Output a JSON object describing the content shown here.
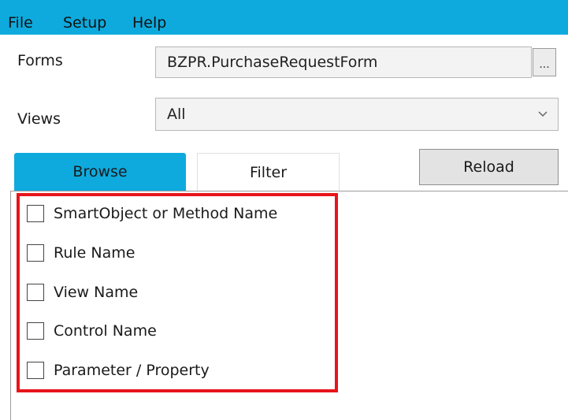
{
  "menu": {
    "file": "File",
    "setup": "Setup",
    "help": "Help"
  },
  "forms": {
    "label": "Forms",
    "value": "BZPR.PurchaseRequestForm",
    "browse_label": "..."
  },
  "views": {
    "label": "Views",
    "selected": "All"
  },
  "tabs": [
    {
      "label": "Browse",
      "active": true
    },
    {
      "label": "Filter",
      "active": false
    }
  ],
  "reload_label": "Reload",
  "filters": [
    {
      "label": "SmartObject or Method Name",
      "checked": false
    },
    {
      "label": "Rule Name",
      "checked": false
    },
    {
      "label": "View Name",
      "checked": false
    },
    {
      "label": "Control Name",
      "checked": false
    },
    {
      "label": "Parameter / Property",
      "checked": false
    }
  ],
  "colors": {
    "accent": "#0eaadd",
    "highlight": "#e8141c"
  }
}
